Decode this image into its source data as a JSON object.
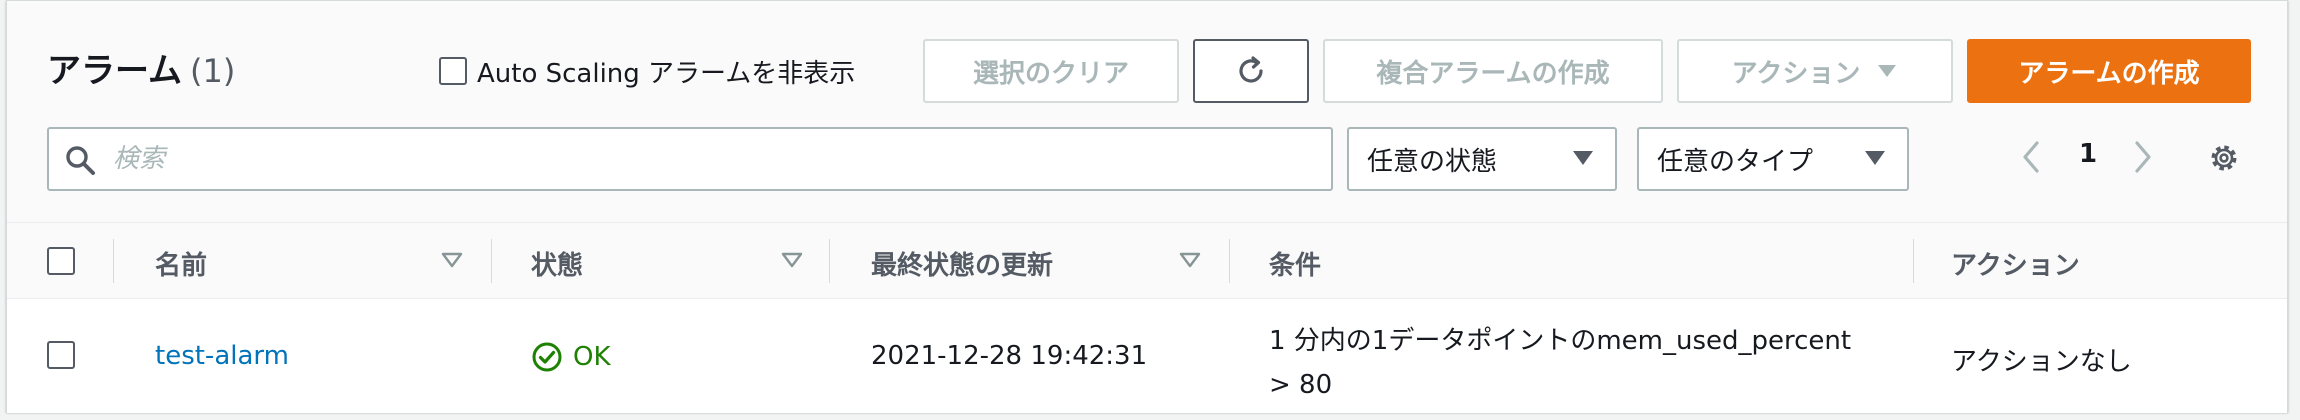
{
  "header": {
    "title": "アラーム",
    "count": "(1)",
    "hide_autoscaling_label": "Auto Scaling アラームを非表示",
    "clear_selection_label": "選択のクリア",
    "composite_alarm_label": "複合アラームの作成",
    "actions_label": "アクション",
    "create_alarm_label": "アラームの作成"
  },
  "filters": {
    "search_placeholder": "検索",
    "state_select": "任意の状態",
    "type_select": "任意のタイプ"
  },
  "pagination": {
    "current_page": "1"
  },
  "table": {
    "columns": {
      "name": "名前",
      "state": "状態",
      "last_update": "最終状態の更新",
      "conditions": "条件",
      "actions": "アクション"
    },
    "rows": [
      {
        "name": "test-alarm",
        "state": "OK",
        "last_update": "2021-12-28 19:42:31",
        "condition_line1": "1 分内の1データポイントのmem_used_percent",
        "condition_line2": "> 80",
        "actions": "アクションなし"
      }
    ]
  },
  "colors": {
    "primary": "#ec7211",
    "link": "#0073bb",
    "ok": "#1d8102",
    "disabled": "#aab7b8"
  },
  "icons": [
    "checkbox-icon",
    "refresh-icon",
    "caret-down-icon",
    "search-icon",
    "chevron-left-icon",
    "chevron-right-icon",
    "gear-icon",
    "sort-icon",
    "status-ok-icon"
  ]
}
